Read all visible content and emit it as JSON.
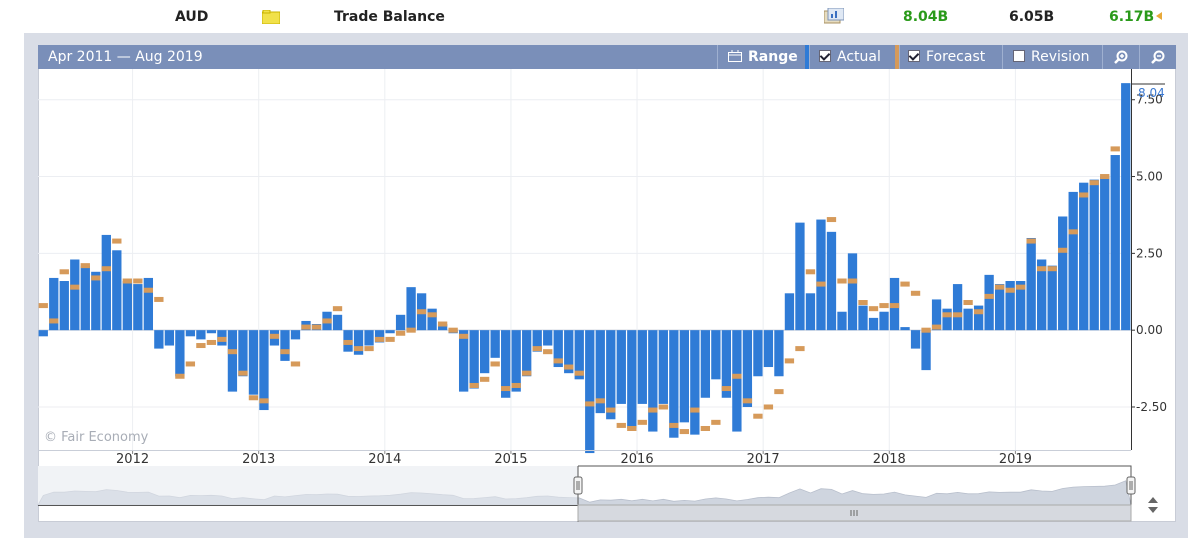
{
  "row": {
    "currency": "AUD",
    "event": "Trade Balance",
    "actual": "8.04B",
    "forecast": "6.05B",
    "previous": "6.17B",
    "actual_color": "#2a9a1a",
    "previous_color": "#2a9a1a"
  },
  "toolbar": {
    "range_text": "Apr 2011 — Aug 2019",
    "range_label": "Range",
    "actual_label": "Actual",
    "forecast_label": "Forecast",
    "revision_label": "Revision",
    "zoom_in_icon": "zoom-in-icon",
    "zoom_out_icon": "zoom-out-icon"
  },
  "watermark": "© Fair Economy",
  "chart_data": {
    "type": "bar",
    "title": "",
    "xlabel": "",
    "ylabel": "",
    "ylim": [
      -3.9,
      8.5
    ],
    "yticks": [
      7.5,
      5.0,
      2.5,
      0.0,
      -2.5
    ],
    "ytick_labels": [
      "7.50",
      "5.00",
      "2.50",
      "0.00",
      "-2.50"
    ],
    "year_labels": [
      "2012",
      "2013",
      "2014",
      "2015",
      "2016",
      "2017",
      "2018",
      "2019"
    ],
    "start": "2011-04",
    "end": "2019-08",
    "last_value_label": "8.04",
    "colors": {
      "actual": "#2f7bd6",
      "forecast": "#d69a5a"
    },
    "series": [
      {
        "name": "Actual",
        "values": [
          -0.2,
          1.7,
          1.6,
          2.3,
          2.1,
          1.9,
          3.1,
          2.6,
          1.6,
          1.5,
          1.7,
          -0.6,
          -0.5,
          -1.5,
          -0.2,
          -0.3,
          -0.1,
          -0.5,
          -2.0,
          -1.5,
          -2.1,
          -2.6,
          -0.5,
          -1.0,
          -0.3,
          0.3,
          0.2,
          0.6,
          0.5,
          -0.7,
          -0.8,
          -0.5,
          -0.4,
          -0.1,
          0.5,
          1.4,
          1.2,
          0.7,
          0.2,
          -0.1,
          -2.0,
          -1.9,
          -1.4,
          -0.9,
          -2.2,
          -2.0,
          -1.5,
          -0.7,
          -0.5,
          -1.2,
          -1.4,
          -1.6,
          -4.0,
          -2.7,
          -2.9,
          -2.4,
          -3.2,
          -2.4,
          -3.3,
          -2.4,
          -3.5,
          -3.0,
          -3.4,
          -2.2,
          -1.6,
          -2.2,
          -3.3,
          -2.5,
          -1.5,
          -1.2,
          -1.5,
          1.2,
          3.5,
          1.2,
          3.6,
          3.2,
          0.6,
          2.5,
          0.8,
          0.4,
          0.6,
          1.7,
          0.1,
          -0.6,
          -1.3,
          1.0,
          0.7,
          1.5,
          0.7,
          0.8,
          1.8,
          1.5,
          1.6,
          1.6,
          3.0,
          2.3,
          2.1,
          3.7,
          4.5,
          4.8,
          4.9,
          5.0,
          5.7,
          8.04
        ]
      },
      {
        "name": "Forecast",
        "values": [
          0.8,
          0.3,
          1.9,
          1.4,
          2.1,
          1.7,
          2.0,
          2.9,
          1.6,
          1.6,
          1.3,
          1.0,
          null,
          -1.5,
          -1.1,
          -0.5,
          -0.4,
          -0.3,
          -0.7,
          -1.4,
          -2.2,
          -2.3,
          -0.2,
          -0.7,
          -1.1,
          0.1,
          0.1,
          0.3,
          0.7,
          -0.4,
          -0.6,
          -0.6,
          -0.3,
          -0.3,
          -0.1,
          0.0,
          0.6,
          0.5,
          0.2,
          0.0,
          -0.2,
          -1.8,
          -1.6,
          -1.1,
          -1.9,
          -1.8,
          -1.4,
          -0.6,
          -0.7,
          -1.0,
          -1.2,
          -1.4,
          -2.4,
          -2.3,
          -2.6,
          -3.1,
          -3.2,
          -3.0,
          -2.6,
          -2.5,
          -3.1,
          -3.3,
          -2.6,
          -3.2,
          -3.0,
          -1.9,
          -1.5,
          -2.3,
          -2.8,
          -2.5,
          -2.0,
          -1.0,
          -0.6,
          1.9,
          1.5,
          3.6,
          1.6,
          1.6,
          0.9,
          0.7,
          0.8,
          0.8,
          1.5,
          1.2,
          0.0,
          0.1,
          0.5,
          0.5,
          0.9,
          0.6,
          1.1,
          1.4,
          1.3,
          1.4,
          2.9,
          2.0,
          2.0,
          2.6,
          3.2,
          4.4,
          4.8,
          5.0,
          5.9
        ]
      }
    ]
  }
}
